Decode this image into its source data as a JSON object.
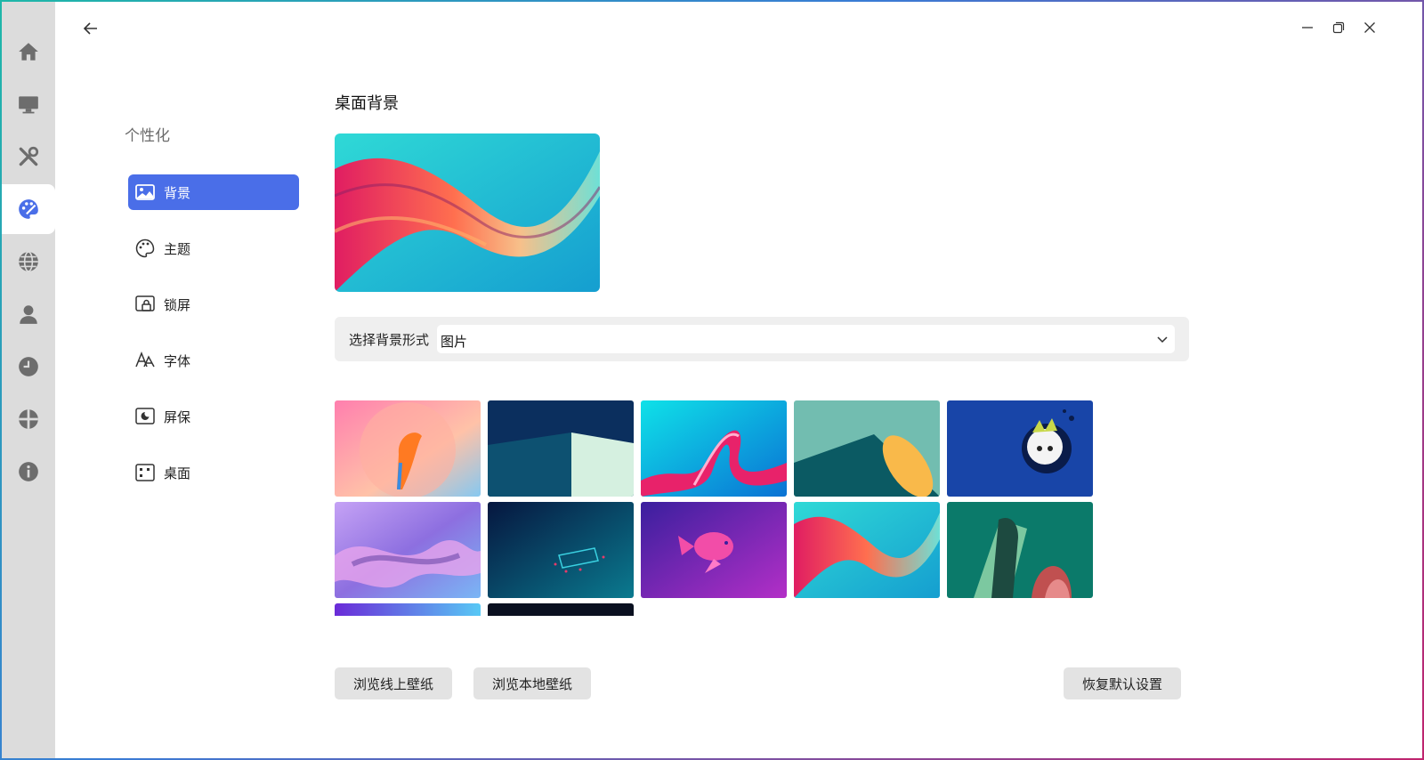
{
  "section_title": "个性化",
  "nav": [
    {
      "label": "背景",
      "icon": "image-icon",
      "active": true
    },
    {
      "label": "主题",
      "icon": "palette-icon",
      "active": false
    },
    {
      "label": "锁屏",
      "icon": "lock-screen-icon",
      "active": false
    },
    {
      "label": "字体",
      "icon": "font-icon",
      "active": false
    },
    {
      "label": "屏保",
      "icon": "screensaver-icon",
      "active": false
    },
    {
      "label": "桌面",
      "icon": "desktop-grid-icon",
      "active": false
    }
  ],
  "rail": [
    "home-icon",
    "display-icon",
    "tools-icon",
    "personalize-icon",
    "network-icon",
    "account-icon",
    "clock-icon",
    "applications-icon",
    "info-icon"
  ],
  "main": {
    "title": "桌面背景",
    "select_label": "选择背景形式",
    "select_value": "图片"
  },
  "buttons": {
    "online": "浏览线上壁纸",
    "local": "浏览本地壁纸",
    "reset": "恢复默认设置"
  },
  "colors": {
    "accent": "#4a6ee8",
    "rail_bg": "#dcdcdc",
    "icon_gray": "#6d6d6d"
  }
}
